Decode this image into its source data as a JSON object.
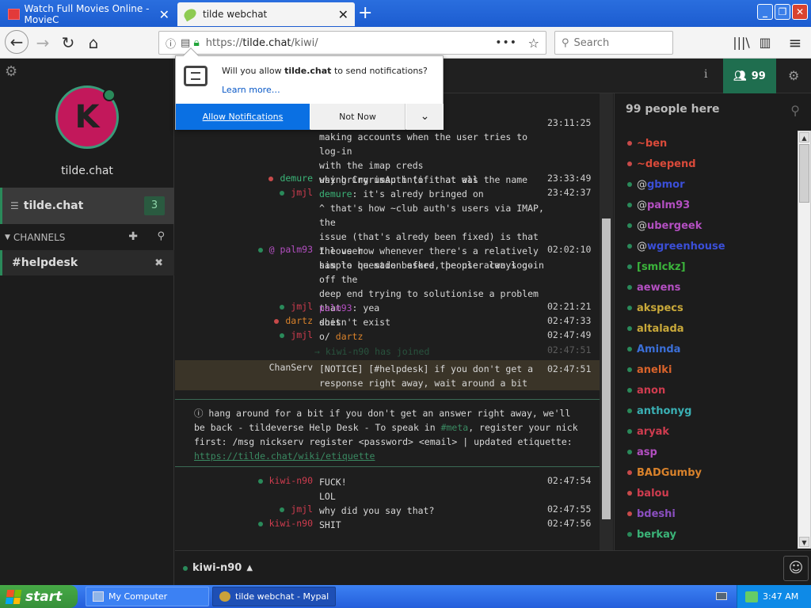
{
  "browser": {
    "tabs": [
      {
        "title": "Watch Full Movies Online - MovieC",
        "active": false
      },
      {
        "title": "tilde webchat",
        "active": true
      }
    ],
    "url_prefix": "https://",
    "url_host": "tilde.chat",
    "url_path": "/kiwi/",
    "search_placeholder": "Search"
  },
  "notification": {
    "message_prefix": "Will you allow ",
    "message_host": "tilde.chat",
    "message_suffix": " to send notifications?",
    "learn_more": "Learn more…",
    "allow": "Allow Notifications",
    "not_now": "Not Now"
  },
  "sidebar": {
    "avatar_letter": "K",
    "network_label": "tilde.chat",
    "network_item": "tilde.chat",
    "network_badge": "3",
    "channels_header": "CHANNELS",
    "channel": "#helpdesk"
  },
  "header": {
    "user_count": "99"
  },
  "messages": [
    {
      "nick": "",
      "time": "23:11:25",
      "lines": [
        ""
      ]
    },
    {
      "nick": "",
      "time": "",
      "lines": [
        "making accounts when the user tries to log-in",
        "with the imap creds",
        "using CryrusAuth (if that was the name"
      ]
    },
    {
      "nick": "demure",
      "time": "23:33:49",
      "lines": [
        "why bring imap into it at all"
      ]
    },
    {
      "nick": "jmjl",
      "time": "23:42:37",
      "lines": [
        "demure: it's alredy bringed on"
      ]
    },
    {
      "nick": "",
      "time": "",
      "lines": [
        "^ that's how ~club auth's users via IMAP, the",
        "issue (that's alredy been fixed) is that the user",
        "has to be made before the user can log-in"
      ]
    },
    {
      "nick": "@ palm93",
      "time": "02:02:10",
      "lines": [
        "I love how whenever there's a relatively",
        "simple question asked, people always go off the",
        "deep end trying to solutionise a problem that",
        "doesn't exist"
      ]
    },
    {
      "nick": "jmjl",
      "time": "02:21:21",
      "lines": [
        "palm93: yea"
      ]
    },
    {
      "nick": "dartz",
      "time": "02:47:33",
      "lines": [
        "shit"
      ]
    },
    {
      "nick": "jmjl",
      "time": "02:47:49",
      "lines": [
        "o/ dartz"
      ]
    },
    {
      "nick": "",
      "time": "02:47:51",
      "lines": [
        "→ kiwi-n90 has joined"
      ]
    },
    {
      "nick": "ChanServ",
      "time": "02:47:51",
      "lines": [
        "[NOTICE] [#helpdesk] if you don't get a",
        "response right away, wait around a bit"
      ]
    },
    {
      "nick": "kiwi-n90",
      "time": "02:47:54",
      "lines": [
        "FUCK!",
        "LOL"
      ]
    },
    {
      "nick": "jmjl",
      "time": "02:47:55",
      "lines": [
        "why did you say that?"
      ]
    },
    {
      "nick": "kiwi-n90",
      "time": "02:47:56",
      "lines": [
        "SHIT"
      ]
    }
  ],
  "topic": {
    "line1": "ⓘ hang around for a bit if you don't get an answer right away, we'll",
    "line2a": "be back - tildeverse Help Desk - To speak in ",
    "line2_meta": "#meta",
    "line2b": ", register your nick",
    "line3": "first: /msg nickserv register <password> <email> | updated etiquette:",
    "link": "https://tilde.chat/wiki/etiquette"
  },
  "userlist": {
    "title": "99 people here",
    "users": [
      {
        "prefix": "",
        "name": "~ben",
        "color": "#d94a3a",
        "dot": "#c84a4a"
      },
      {
        "prefix": "",
        "name": "~deepend",
        "color": "#d94a3a",
        "dot": "#c84a4a"
      },
      {
        "prefix": "@",
        "name": "gbmor",
        "color": "#3b4fd8",
        "dot": "#2a8a5a"
      },
      {
        "prefix": "@",
        "name": "palm93",
        "color": "#b34fc1",
        "dot": "#2a8a5a"
      },
      {
        "prefix": "@",
        "name": "ubergeek",
        "color": "#b34fc1",
        "dot": "#2a8a5a"
      },
      {
        "prefix": "@",
        "name": "wgreenhouse",
        "color": "#3b4fd8",
        "dot": "#2a8a5a"
      },
      {
        "prefix": "",
        "name": "[smlckz]",
        "color": "#3bb43b",
        "dot": "#2a8a5a"
      },
      {
        "prefix": "",
        "name": "aewens",
        "color": "#b34fc1",
        "dot": "#2a8a5a"
      },
      {
        "prefix": "",
        "name": "akspecs",
        "color": "#c9a93a",
        "dot": "#2a8a5a"
      },
      {
        "prefix": "",
        "name": "altalada",
        "color": "#c9a93a",
        "dot": "#2a8a5a"
      },
      {
        "prefix": "",
        "name": "Aminda",
        "color": "#3b6fd8",
        "dot": "#2a8a5a"
      },
      {
        "prefix": "",
        "name": "anelki",
        "color": "#d9632b",
        "dot": "#2a8a5a"
      },
      {
        "prefix": "",
        "name": "anon",
        "color": "#cf3c4f",
        "dot": "#2a8a5a"
      },
      {
        "prefix": "",
        "name": "anthonyg",
        "color": "#3ab0b4",
        "dot": "#2a8a5a"
      },
      {
        "prefix": "",
        "name": "aryak",
        "color": "#cf3c4f",
        "dot": "#2a8a5a"
      },
      {
        "prefix": "",
        "name": "asp",
        "color": "#b34fc1",
        "dot": "#2a8a5a"
      },
      {
        "prefix": "",
        "name": "BADGumby",
        "color": "#d9822b",
        "dot": "#c84a4a"
      },
      {
        "prefix": "",
        "name": "balou",
        "color": "#cf3c4f",
        "dot": "#c84a4a"
      },
      {
        "prefix": "",
        "name": "bdeshi",
        "color": "#8b4fc1",
        "dot": "#c84a4a"
      },
      {
        "prefix": "",
        "name": "berkay",
        "color": "#3bb478",
        "dot": "#2a8a5a"
      }
    ]
  },
  "input": {
    "nick": "kiwi-n90"
  },
  "taskbar": {
    "start": "start",
    "task1": "My Computer",
    "task2": "tilde webchat - Mypal",
    "clock": "3:47 AM"
  }
}
